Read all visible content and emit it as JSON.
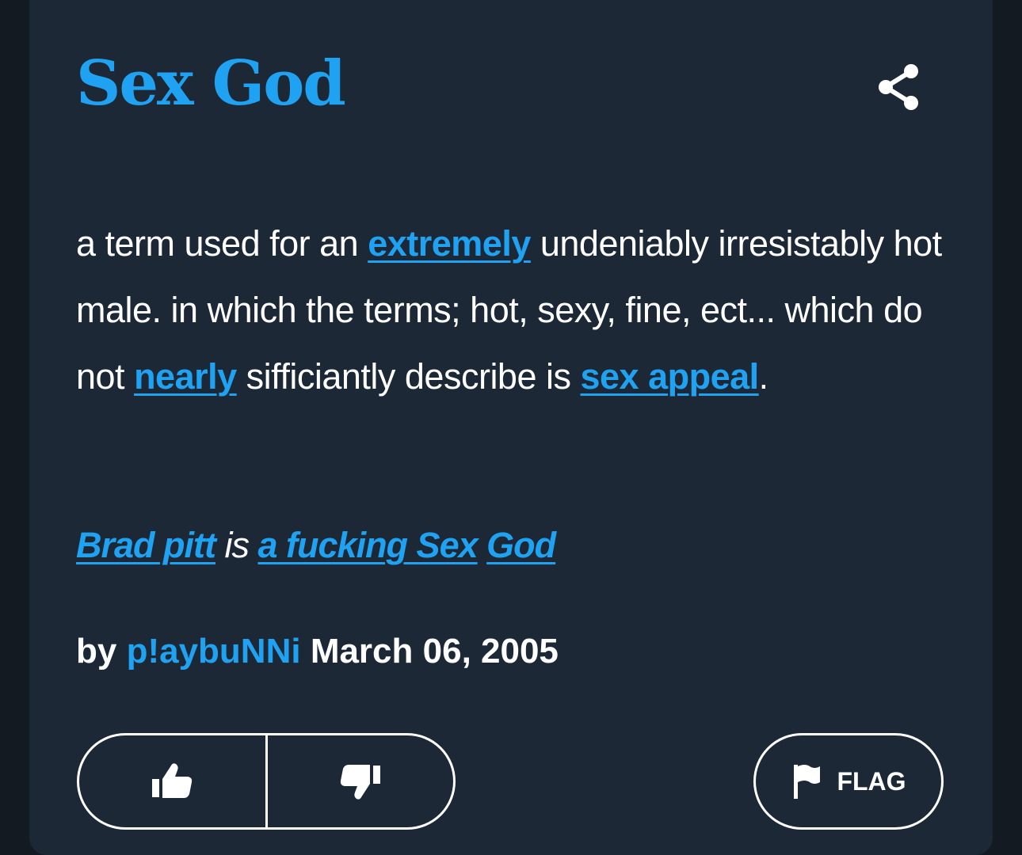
{
  "entry": {
    "word": "Sex God",
    "definition": {
      "t1": "a term used for an ",
      "l1": "extremely",
      "t2": " undeniably irresistably hot male. in which the terms; hot, sexy, fine, ect... which do not ",
      "l2": "nearly",
      "t3": " sifficiantly describe is ",
      "l3": "sex appeal",
      "t4": "."
    },
    "example": {
      "l1": "Brad pitt",
      "t1": " is ",
      "l2": "a fucking Sex",
      "t2": " ",
      "l3": "God"
    },
    "byline": {
      "prefix": "by ",
      "author": "p!aybuNNi",
      "date": "March 06, 2005"
    }
  },
  "actions": {
    "flag_label": "FLAG"
  },
  "icons": {
    "share": "share-icon",
    "upvote": "thumbs-up-icon",
    "downvote": "thumbs-down-icon",
    "flag": "flag-icon"
  },
  "colors": {
    "background": "#131a22",
    "card": "#1d2837",
    "accent": "#1fa2f1",
    "text": "#ffffff"
  }
}
